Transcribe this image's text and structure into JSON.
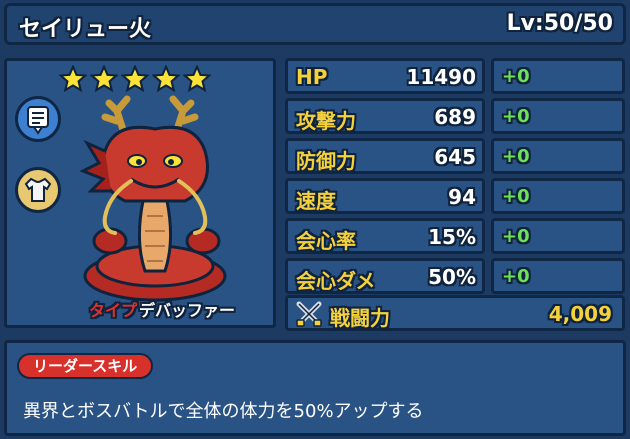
{
  "header": {
    "name": "セイリュー火",
    "level": "Lv:50/50"
  },
  "portrait": {
    "stars": 5,
    "icons": [
      "memo-icon",
      "shirt-icon"
    ],
    "type_label": "タイプ",
    "type_value": "デバッファー"
  },
  "stats": [
    {
      "label": "HP",
      "value": "11490",
      "bonus": "+0"
    },
    {
      "label": "攻撃力",
      "value": "689",
      "bonus": "+0"
    },
    {
      "label": "防御力",
      "value": "645",
      "bonus": "+0"
    },
    {
      "label": "速度",
      "value": "94",
      "bonus": "+0"
    },
    {
      "label": "会心率",
      "value": "15%",
      "bonus": "+0"
    },
    {
      "label": "会心ダメ",
      "value": "50%",
      "bonus": "+0"
    }
  ],
  "power": {
    "label": "戦闘力",
    "value": "4,009"
  },
  "skill": {
    "badge": "リーダースキル",
    "description": "異界とボスバトルで全体の体力を50%アップする"
  },
  "colors": {
    "panel": "#2a5385",
    "border": "#0f2744",
    "label_yellow": "#f5d23c",
    "bonus_green": "#6de05a",
    "badge_red": "#d8302a"
  }
}
